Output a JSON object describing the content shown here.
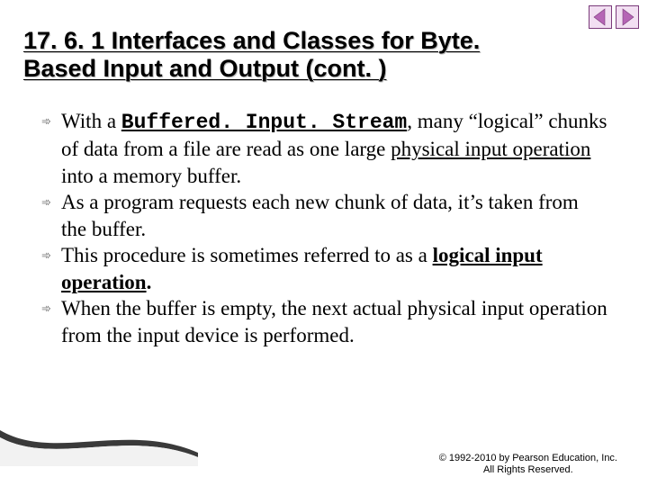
{
  "nav": {
    "prev_icon": "prev-slide",
    "next_icon": "next-slide"
  },
  "title": {
    "line1": "17. 6. 1 Interfaces and Classes for Byte.",
    "line2": "Based Input and Output (cont. )"
  },
  "bullets": [
    {
      "pre": "With a ",
      "code": "Buffered. Input. Stream",
      "mid1": ", many “logical” chunks of data from a file are read as one large ",
      "emph": "physical input operation",
      "post": " into a memory buffer."
    },
    {
      "text": "As a program requests each new chunk of data, it’s taken from the buffer."
    },
    {
      "pre": "This procedure is sometimes referred to as a ",
      "emph": "logical input operation",
      "post": "."
    },
    {
      "text": "When the buffer is empty, the next actual physical input operation from the input device is performed."
    }
  ],
  "footer": {
    "line1": "© 1992-2010 by Pearson Education, Inc.",
    "line2": "All Rights Reserved."
  }
}
